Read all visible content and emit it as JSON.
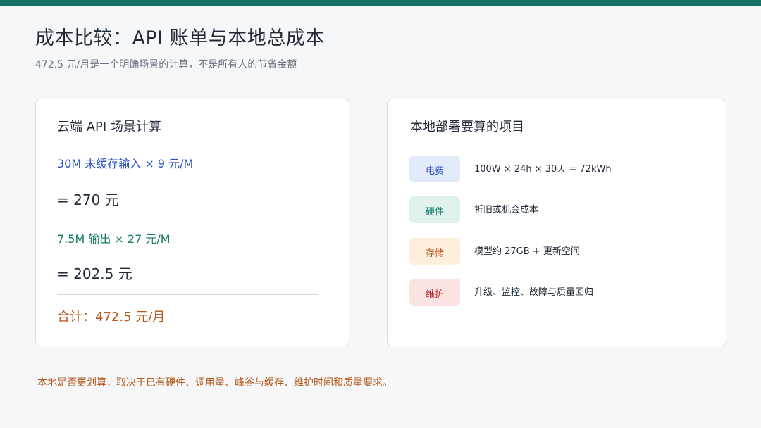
{
  "header": {
    "title": "成本比较：API 账单与本地总成本",
    "subtitle": "472.5 元/月是一个明确场景的计算，不是所有人的节省金额",
    "accent_color": "#137262"
  },
  "cloud_card": {
    "title": "云端 API 场景计算",
    "input_line": "30M 未缓存输入 × 9 元/M",
    "input_result": "= 270 元",
    "output_line": "7.5M 输出 × 27 元/M",
    "output_result": "= 202.5 元",
    "total": "合计：472.5 元/月"
  },
  "local_card": {
    "title": "本地部署要算的项目",
    "items": [
      {
        "tag": "电费",
        "description": "100W × 24h × 30天 = 72kWh",
        "color": "#2a4fc9"
      },
      {
        "tag": "硬件",
        "description": "折旧或机会成本",
        "color": "#147a66"
      },
      {
        "tag": "存储",
        "description": "模型约 27GB + 更新空间",
        "color": "#b5581a"
      },
      {
        "tag": "维护",
        "description": "升级、监控、故障与质量回归",
        "color": "#b42323"
      }
    ]
  },
  "footer": {
    "note": "本地是否更划算，取决于已有硬件、调用量、峰谷与缓存、维护时间和质量要求。"
  }
}
